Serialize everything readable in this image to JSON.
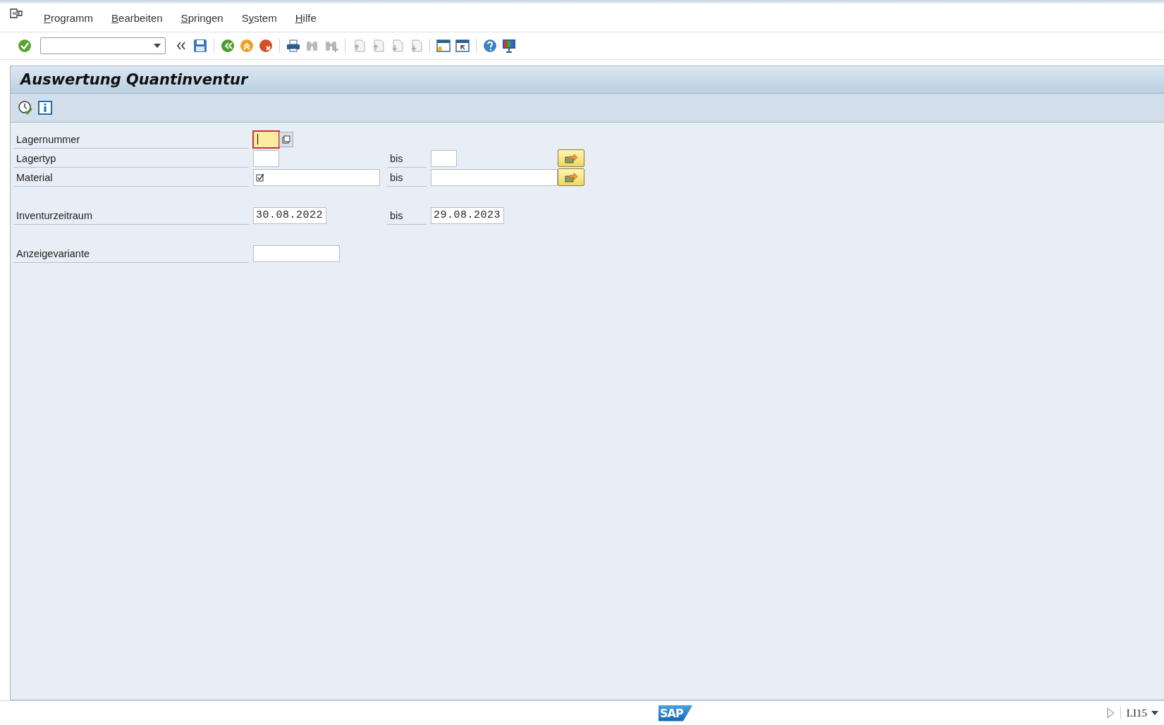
{
  "menu": {
    "items": [
      {
        "key": "P",
        "after": "rogramm"
      },
      {
        "key": "B",
        "after": "earbeiten"
      },
      {
        "key": "S",
        "after": "pringen"
      },
      {
        "before": "S",
        "key": "y",
        "after": "stem"
      },
      {
        "key": "H",
        "after": "ilfe"
      }
    ]
  },
  "toolbar": {
    "groups": [
      {
        "items": [
          {
            "kind": "check",
            "disabled": false
          }
        ]
      },
      {
        "items": [
          {
            "kind": "collapse",
            "disabled": false
          },
          {
            "kind": "save",
            "disabled": false
          }
        ]
      },
      {
        "items": [
          {
            "kind": "back",
            "disabled": false
          },
          {
            "kind": "exit",
            "disabled": false
          },
          {
            "kind": "cancel",
            "disabled": false
          }
        ]
      },
      {
        "items": [
          {
            "kind": "print",
            "disabled": false
          },
          {
            "kind": "find",
            "disabled": true
          },
          {
            "kind": "findnext",
            "disabled": true
          }
        ]
      },
      {
        "items": [
          {
            "kind": "first",
            "disabled": true
          },
          {
            "kind": "previous",
            "disabled": true
          },
          {
            "kind": "next",
            "disabled": true
          },
          {
            "kind": "last",
            "disabled": true
          }
        ]
      },
      {
        "items": [
          {
            "kind": "session",
            "disabled": false
          },
          {
            "kind": "shortcut",
            "disabled": false
          }
        ]
      },
      {
        "items": [
          {
            "kind": "help",
            "disabled": false
          },
          {
            "kind": "layout",
            "disabled": false
          }
        ]
      }
    ]
  },
  "screen": {
    "title": "Auswertung Quantinventur",
    "app_toolbar": [
      {
        "kind": "execute"
      },
      {
        "kind": "info"
      }
    ],
    "sections": [
      {
        "rows": [
          {
            "label": "Lagernummer",
            "kind": "code",
            "low": {
              "focused": true,
              "required": false
            },
            "button": {
              "kind": "values"
            }
          },
          {
            "label": "Lagertyp",
            "kind": "code",
            "low": {
              "focused": false,
              "required": false
            },
            "to_label": "bis",
            "high": {
              "focused": false
            },
            "button": {
              "kind": "selection"
            }
          },
          {
            "label": "Material",
            "kind": "material",
            "low": {
              "focused": false,
              "required": true
            },
            "to_label": "bis",
            "high": {
              "focused": false
            },
            "button": {
              "kind": "selection"
            }
          }
        ]
      },
      {
        "rows": [
          {
            "label": "Inventurzeitraum",
            "kind": "date",
            "low": {
              "value": "30.08.2022",
              "focused": false,
              "required": false
            },
            "to_label": "bis",
            "high": {
              "value": "29.08.2023",
              "focused": false
            }
          }
        ]
      },
      {
        "rows": [
          {
            "label": "Anzeigevariante",
            "kind": "variant",
            "low": {
              "focused": false,
              "required": false
            }
          }
        ]
      }
    ]
  },
  "status_bar": {
    "logo": "SAP",
    "transaction": "LI15"
  }
}
